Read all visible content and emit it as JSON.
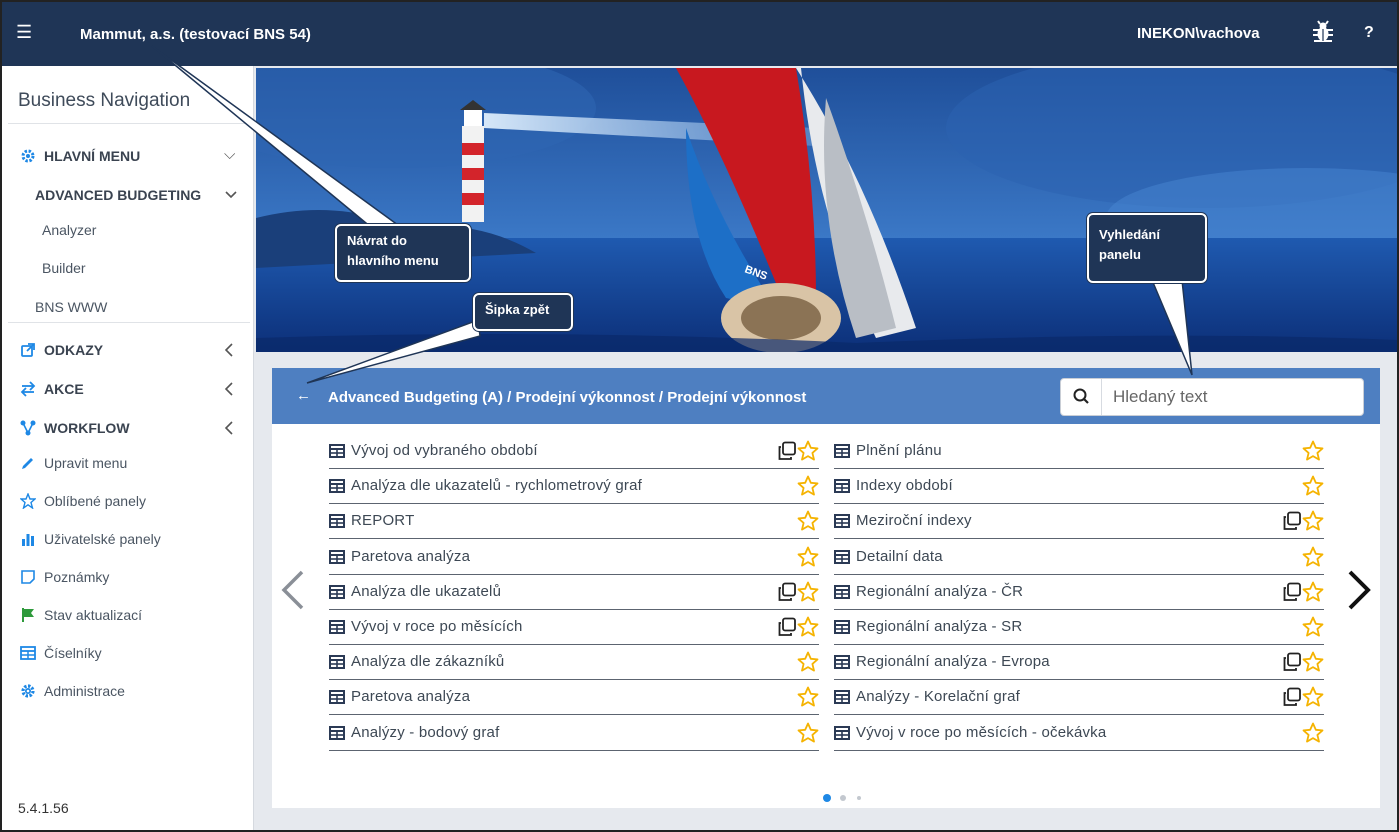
{
  "topbar": {
    "company": "Mammut, a.s. (testovací BNS 54)",
    "user": "INEKON\\vachova",
    "help": "?",
    "menu_icon": "hamburger-icon",
    "bug_icon": "bug-icon"
  },
  "sidebar": {
    "brand": "Business Navigation",
    "main_menu": "HLAVNÍ MENU",
    "advanced_budgeting": "ADVANCED BUDGETING",
    "analyzer": "Analyzer",
    "builder": "Builder",
    "bns_www": "BNS WWW",
    "links": "ODKAZY",
    "actions": "AKCE",
    "workflow": "WORKFLOW",
    "edit_menu": "Upravit menu",
    "favorites": "Oblíbené panely",
    "user_panels": "Uživatelské panely",
    "notes": "Poznámky",
    "update_status": "Stav aktualizací",
    "codebooks": "Číselníky",
    "administration": "Administrace",
    "version": "5.4.1.56"
  },
  "banner": {
    "sail_text": "BNS"
  },
  "panel": {
    "back_arrow": "←",
    "breadcrumb": "Advanced Budgeting (A)  /  Prodejní výkonnost  /  Prodejní výkonnost",
    "search_placeholder": "Hledaný text",
    "left_items": [
      {
        "label": "Vývoj od vybraného období",
        "copy": true
      },
      {
        "label": "Analýza dle ukazatelů - rychlometrový graf",
        "copy": false
      },
      {
        "label": "REPORT",
        "copy": false
      },
      {
        "label": "Paretova analýza",
        "copy": false
      },
      {
        "label": "Analýza dle ukazatelů",
        "copy": true
      },
      {
        "label": "Vývoj v roce po měsících",
        "copy": true
      },
      {
        "label": "Analýza dle zákazníků",
        "copy": false
      },
      {
        "label": "Paretova analýza",
        "copy": false
      },
      {
        "label": "Analýzy - bodový graf",
        "copy": false
      }
    ],
    "right_items": [
      {
        "label": "Plnění plánu",
        "copy": false
      },
      {
        "label": "Indexy období",
        "copy": false
      },
      {
        "label": "Meziroční indexy",
        "copy": true
      },
      {
        "label": "Detailní data",
        "copy": false
      },
      {
        "label": "Regionální analýza - ČR",
        "copy": true
      },
      {
        "label": "Regionální analýza - SR",
        "copy": false
      },
      {
        "label": "Regionální analýza - Evropa",
        "copy": true
      },
      {
        "label": "Analýzy - Korelační graf",
        "copy": true
      },
      {
        "label": "Vývoj v roce po měsících - očekávka",
        "copy": false
      }
    ],
    "pages": 3,
    "active_page": 1
  },
  "callouts": {
    "main_menu_line1": "Návrat do",
    "main_menu_line2": "hlavního menu",
    "back_arrow": "Šipka zpět",
    "search_line1": "Vyhledání",
    "search_line2": "panelu"
  },
  "colors": {
    "topbar": "#1f3556",
    "panel_header": "#4e7fc1",
    "star": "#f5b301",
    "accent": "#1e88e5"
  }
}
